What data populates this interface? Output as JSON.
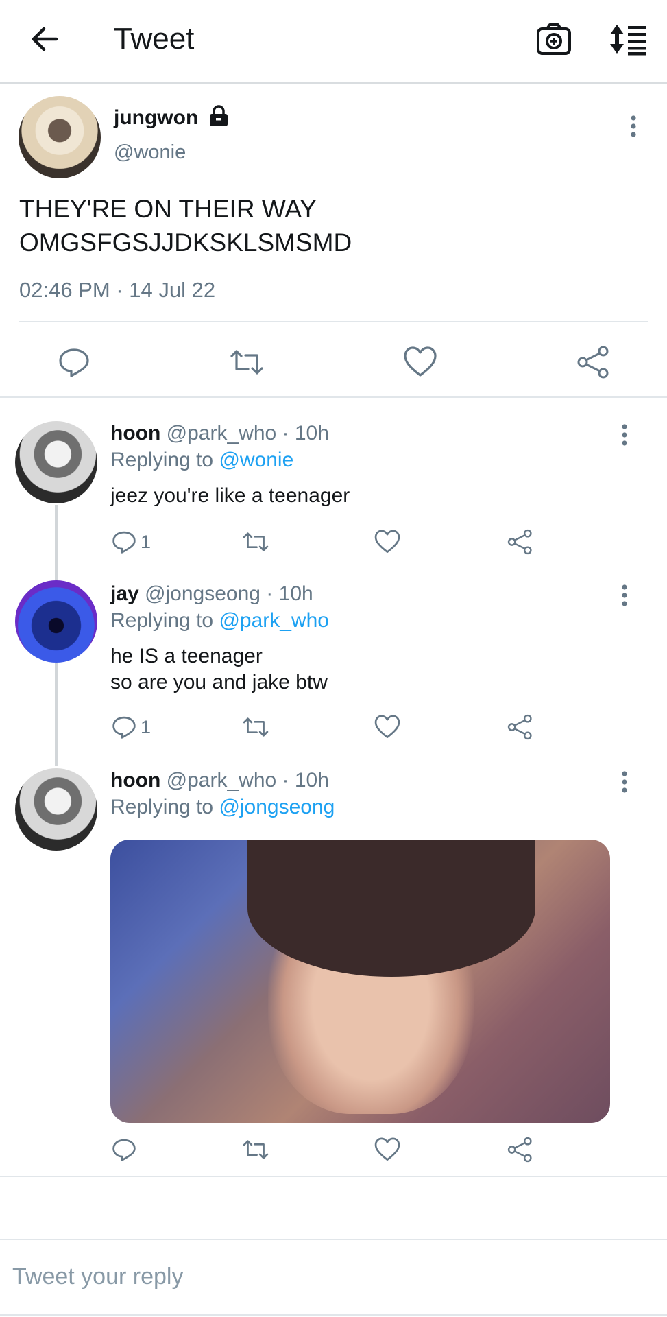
{
  "header": {
    "title": "Tweet",
    "back_icon": "arrow-left-icon",
    "camera_icon": "camera-plus-icon",
    "sort_icon": "sort-list-icon"
  },
  "main_tweet": {
    "name": "jungwon",
    "handle": "@wonie",
    "text": "THEY'RE ON THEIR WAY\nOMGSFGSJJDKSKLSMSMD",
    "timestamp": "02:46 PM · 14 Jul 22",
    "protected_icon": "lock-icon"
  },
  "replies": [
    {
      "name": "hoon",
      "meta": "@park_who · 10h",
      "replying_prefix": "Replying to ",
      "replying_to": "@wonie",
      "text": "jeez you're like a teenager",
      "reply_count": "1"
    },
    {
      "name": "jay",
      "meta": "@jongseong · 10h",
      "replying_prefix": "Replying to ",
      "replying_to": "@park_who",
      "text": "he IS a teenager\nso are you and jake btw",
      "reply_count": "1"
    },
    {
      "name": "hoon",
      "meta": "@park_who · 10h",
      "replying_prefix": "Replying to ",
      "replying_to": "@jongseong",
      "text": "",
      "reply_count": ""
    }
  ],
  "composer": {
    "placeholder": "Tweet your reply"
  },
  "colors": {
    "link": "#1da1f2",
    "secondary_text": "#657786",
    "primary_text": "#14171a"
  }
}
